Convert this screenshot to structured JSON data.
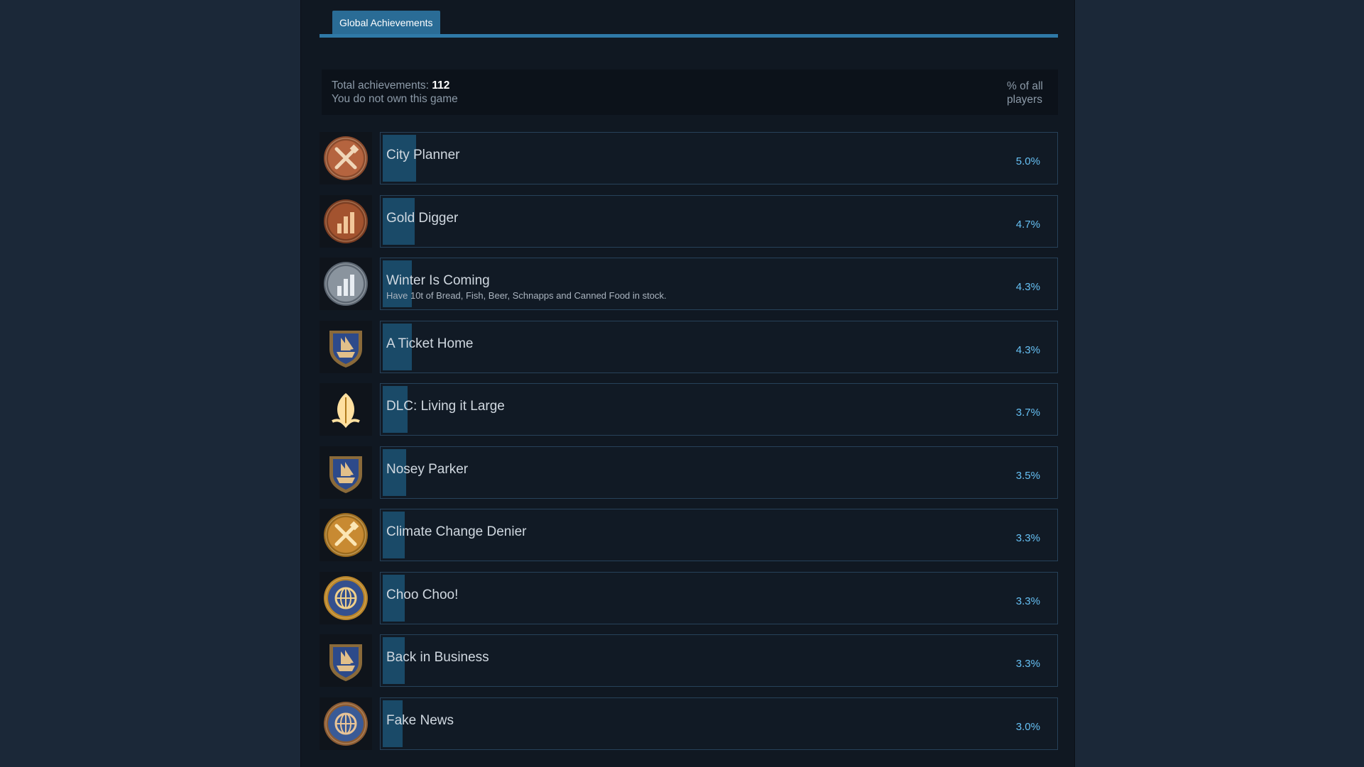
{
  "tab": {
    "label": "Global Achievements"
  },
  "summary": {
    "total_label": "Total achievements:",
    "total_value": "112",
    "ownership": "You do not own this game",
    "pct_header_line1": "% of all",
    "pct_header_line2": "players"
  },
  "colors": {
    "background": "#1b2838",
    "panel": "#101822",
    "tab": "#2a6c96",
    "bar_fill": "#1a4a68",
    "percent_text": "#66c0f4"
  },
  "achievements": [
    {
      "name": "City Planner",
      "description": "",
      "percent": "5.0%",
      "percent_value": 5.0,
      "icon": "bronze-tools-medal-icon"
    },
    {
      "name": "Gold Digger",
      "description": "",
      "percent": "4.7%",
      "percent_value": 4.7,
      "icon": "bronze-gear-chart-icon"
    },
    {
      "name": "Winter Is Coming",
      "description": "Have 10t of Bread, Fish, Beer, Schnapps and Canned Food in stock.",
      "percent": "4.3%",
      "percent_value": 4.3,
      "icon": "silver-gear-chart-icon"
    },
    {
      "name": "A Ticket Home",
      "description": "",
      "percent": "4.3%",
      "percent_value": 4.3,
      "icon": "ship-shield-icon"
    },
    {
      "name": "DLC: Living it Large",
      "description": "",
      "percent": "3.7%",
      "percent_value": 3.7,
      "icon": "golden-leaf-icon"
    },
    {
      "name": "Nosey Parker",
      "description": "",
      "percent": "3.5%",
      "percent_value": 3.5,
      "icon": "ship-shield-icon"
    },
    {
      "name": "Climate Change Denier",
      "description": "",
      "percent": "3.3%",
      "percent_value": 3.3,
      "icon": "gold-tools-medal-icon"
    },
    {
      "name": "Choo Choo!",
      "description": "",
      "percent": "3.3%",
      "percent_value": 3.3,
      "icon": "gold-compass-globe-icon"
    },
    {
      "name": "Back in Business",
      "description": "",
      "percent": "3.3%",
      "percent_value": 3.3,
      "icon": "ship-shield-icon"
    },
    {
      "name": "Fake News",
      "description": "",
      "percent": "3.0%",
      "percent_value": 3.0,
      "icon": "bronze-globe-medal-icon"
    }
  ]
}
